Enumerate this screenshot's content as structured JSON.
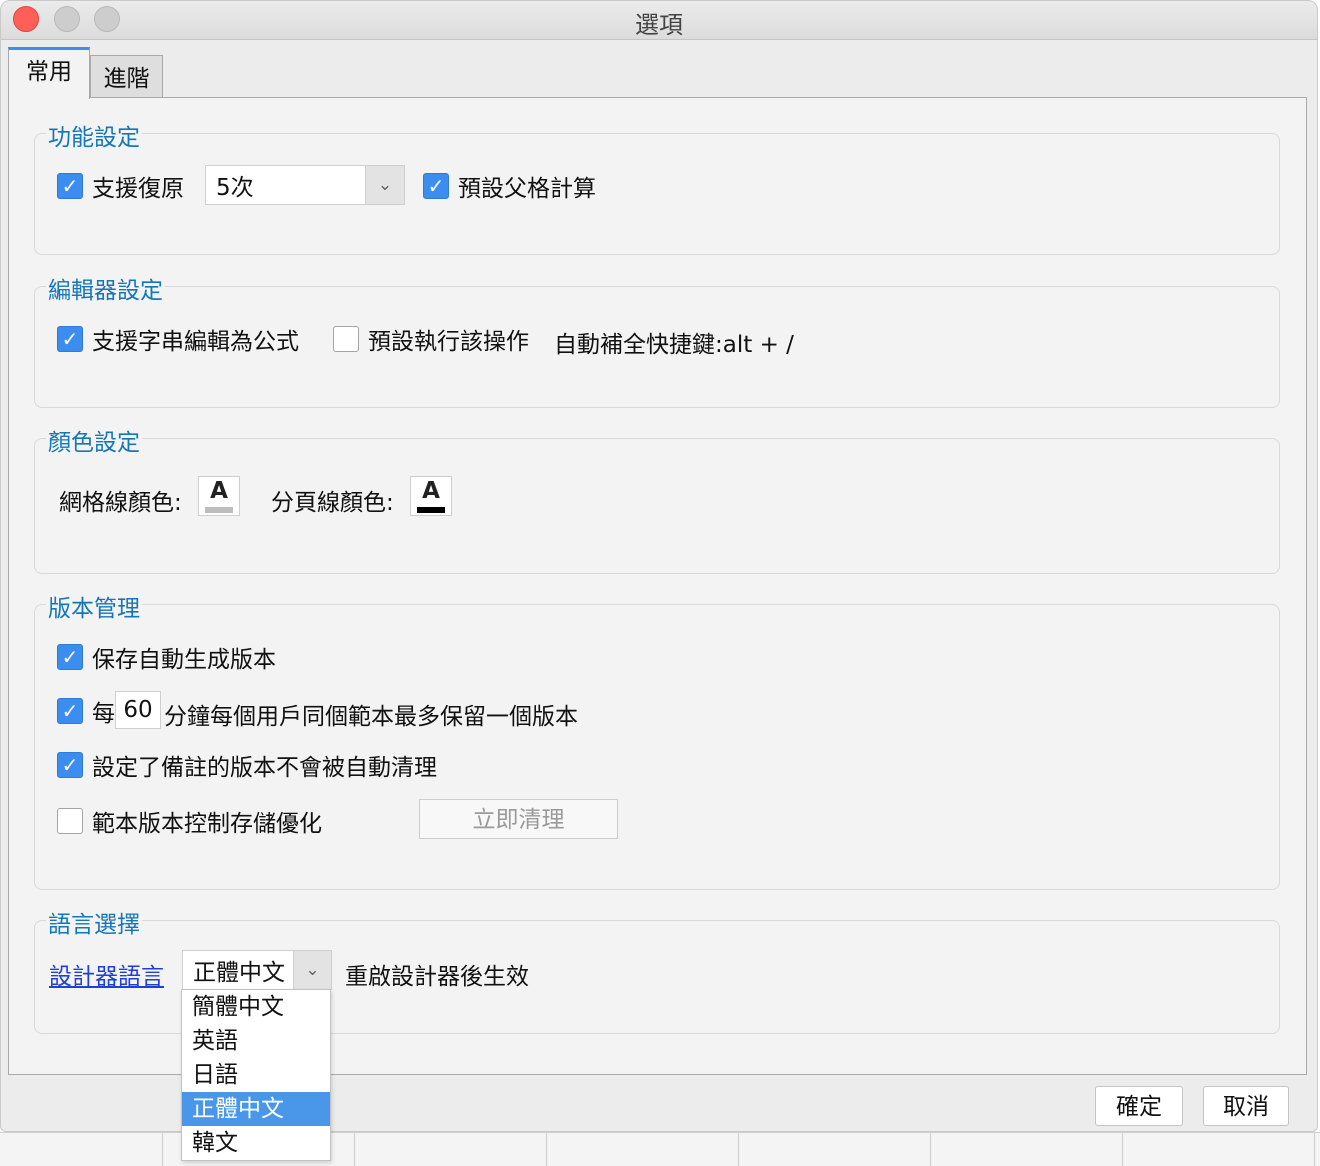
{
  "window": {
    "title": "選項"
  },
  "tabs": {
    "general": "常用",
    "advanced": "進階"
  },
  "function_settings": {
    "legend": "功能設定",
    "undo": {
      "label": "支援復原",
      "checked": true
    },
    "undo_count": "5次",
    "parent_calc": {
      "label": "預設父格計算",
      "checked": true
    }
  },
  "editor_settings": {
    "legend": "編輯器設定",
    "string_formula": {
      "label": "支援字串編輯為公式",
      "checked": true
    },
    "default_execute": {
      "label": "預設執行該操作",
      "checked": false
    },
    "autocomplete_shortcut": "自動補全快捷鍵:alt + /"
  },
  "color_settings": {
    "legend": "顏色設定",
    "grid_line_label": "網格線顏色:",
    "page_line_label": "分頁線顏色:",
    "glyph": "A",
    "grid_line_color": "#bdbdbd",
    "page_line_color": "#000000"
  },
  "version_management": {
    "legend": "版本管理",
    "auto_version": {
      "label": "保存自動生成版本",
      "checked": true
    },
    "interval_prefix": "每",
    "interval_value": "60",
    "interval_suffix": "分鐘每個用戶同個範本最多保留一個版本",
    "interval_checked": true,
    "keep_commented": {
      "label": "設定了備註的版本不會被自動清理",
      "checked": true
    },
    "storage_optimize": {
      "label": "範本版本控制存儲優化",
      "checked": false
    },
    "clean_now": "立即清理"
  },
  "language": {
    "legend": "語言選擇",
    "designer_language": "設計器語言",
    "selected": "正體中文",
    "restart_note": "重啟設計器後生效",
    "options": [
      "簡體中文",
      "英語",
      "日語",
      "正體中文",
      "韓文"
    ],
    "selected_index": 3
  },
  "footer": {
    "ok": "確定",
    "cancel": "取消"
  },
  "icons": {
    "check": "✓",
    "chevron": "⌄"
  }
}
